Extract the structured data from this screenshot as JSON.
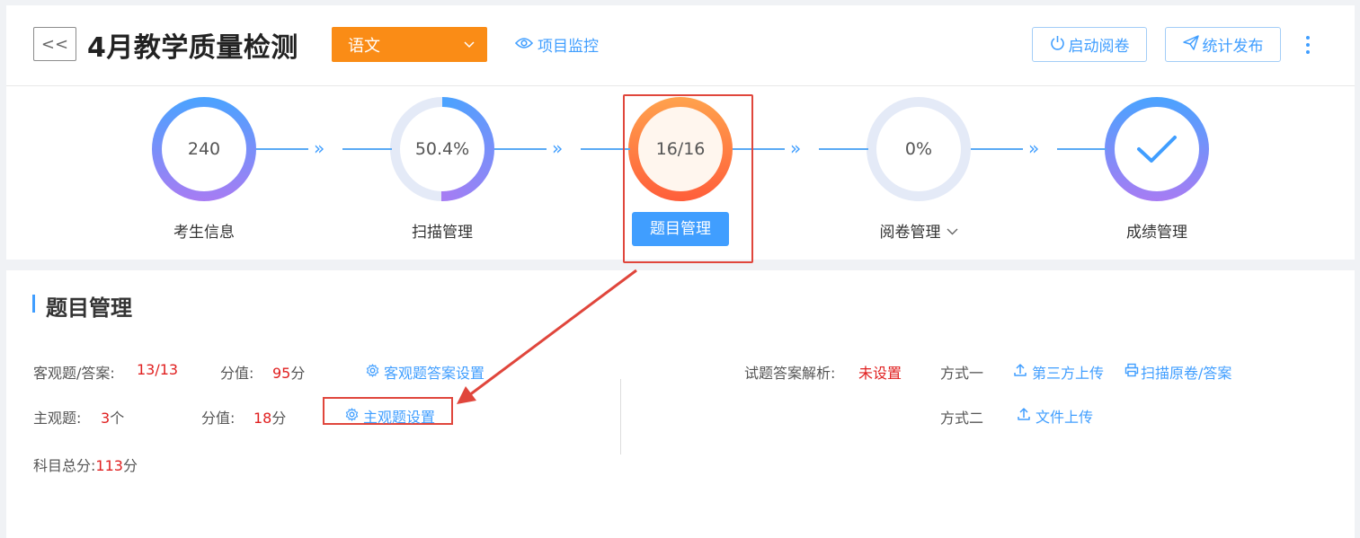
{
  "header": {
    "back_label": "<<",
    "title": "4月教学质量检测",
    "subject": "语文",
    "monitor_label": "项目监控",
    "start_marking_label": "启动阅卷",
    "publish_stats_label": "统计发布"
  },
  "steps": [
    {
      "value": "240",
      "label": "考生信息"
    },
    {
      "value": "50.4%",
      "label": "扫描管理",
      "progress": 0.504
    },
    {
      "value": "16/16",
      "label": "题目管理",
      "active": true
    },
    {
      "value": "0%",
      "label": "阅卷管理",
      "progress": 0
    },
    {
      "value": "",
      "label": "成绩管理",
      "icon": "check-icon"
    }
  ],
  "connector_glyph": "»",
  "section": {
    "title": "题目管理",
    "objective_label": "客观题/答案:",
    "objective_value": "13/13",
    "objective_score_label": "分值:",
    "objective_score_value": "95",
    "objective_score_unit": "分",
    "objective_setting_link": "客观题答案设置",
    "subjective_label": "主观题:",
    "subjective_value": "3",
    "subjective_unit": "个",
    "subjective_score_label": "分值:",
    "subjective_score_value": "18",
    "subjective_score_unit": "分",
    "subjective_setting_link": "主观题设置",
    "total_label": "科目总分:",
    "total_value": "113",
    "total_unit": "分",
    "analysis_label": "试题答案解析:",
    "analysis_status": "未设置",
    "method1_label": "方式一",
    "method1_link1": "第三方上传",
    "method1_link2": "扫描原卷/答案",
    "method2_label": "方式二",
    "method2_link": "文件上传"
  },
  "colors": {
    "accent": "#409eff",
    "orange": "#fa8c16",
    "red": "#e02020",
    "annotation_red": "#e0463c"
  }
}
